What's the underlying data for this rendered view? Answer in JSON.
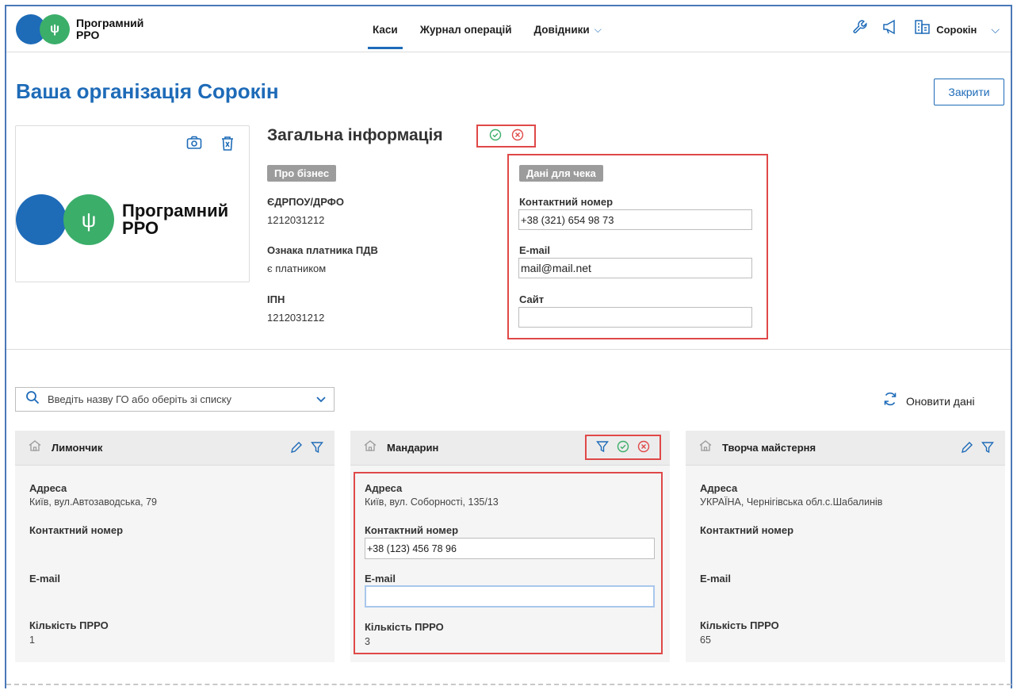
{
  "header": {
    "logo_text": "Програмний РРО",
    "nav": [
      {
        "label": "Каси",
        "active": true
      },
      {
        "label": "Журнал операцій",
        "active": false
      },
      {
        "label": "Довідники",
        "active": false
      }
    ],
    "user": "Сорокін",
    "icons": [
      "wrench-icon",
      "megaphone-icon",
      "building-icon",
      "chevron-down-icon"
    ]
  },
  "page": {
    "title": "Ваша організація Сорокін",
    "close_label": "Закрити"
  },
  "logo_card": {
    "text": "Програмний РРО"
  },
  "general": {
    "title": "Загальна інформація",
    "business_badge": "Про бізнес",
    "edrpou_label": "ЄДРПОУ/ДРФО",
    "edrpou_value": "1212031212",
    "vat_label": "Ознака платника ПДВ",
    "vat_value": "є платником",
    "ipn_label": "ІПН",
    "ipn_value": "1212031212",
    "check_badge": "Дані для чека",
    "phone_label": "Контактний номер",
    "phone_value": "+38 (321) 654 98 73",
    "email_label": "E-mail",
    "email_value": "mail@mail.net",
    "site_label": "Сайт",
    "site_value": ""
  },
  "search": {
    "placeholder": "Введіть назву ГО або оберіть зі списку",
    "refresh_label": "Оновити дані"
  },
  "cards": [
    {
      "name": "Лимончик",
      "address_label": "Адреса",
      "address": "Київ, вул.Автозаводська, 79",
      "phone_label": "Контактний номер",
      "phone": "",
      "email_label": "E-mail",
      "email": "",
      "count_label": "Кількість ПРРО",
      "count": "1"
    },
    {
      "name": "Мандарин",
      "address_label": "Адреса",
      "address": "Київ, вул. Соборності, 135/13",
      "phone_label": "Контактний номер",
      "phone": "+38 (123) 456 78 96",
      "email_label": "E-mail",
      "email": "",
      "count_label": "Кількість ПРРО",
      "count": "3"
    },
    {
      "name": "Творча майстерня",
      "address_label": "Адреса",
      "address": "УКРАЇНА, Чернігівська обл.с.Шабалинів",
      "phone_label": "Контактний номер",
      "phone": "",
      "email_label": "E-mail",
      "email": "",
      "count_label": "Кількість ПРРО",
      "count": "65"
    }
  ],
  "colors": {
    "brand_blue": "#1e6bb8",
    "brand_green": "#3bae6a",
    "highlight_red": "#e04848"
  }
}
